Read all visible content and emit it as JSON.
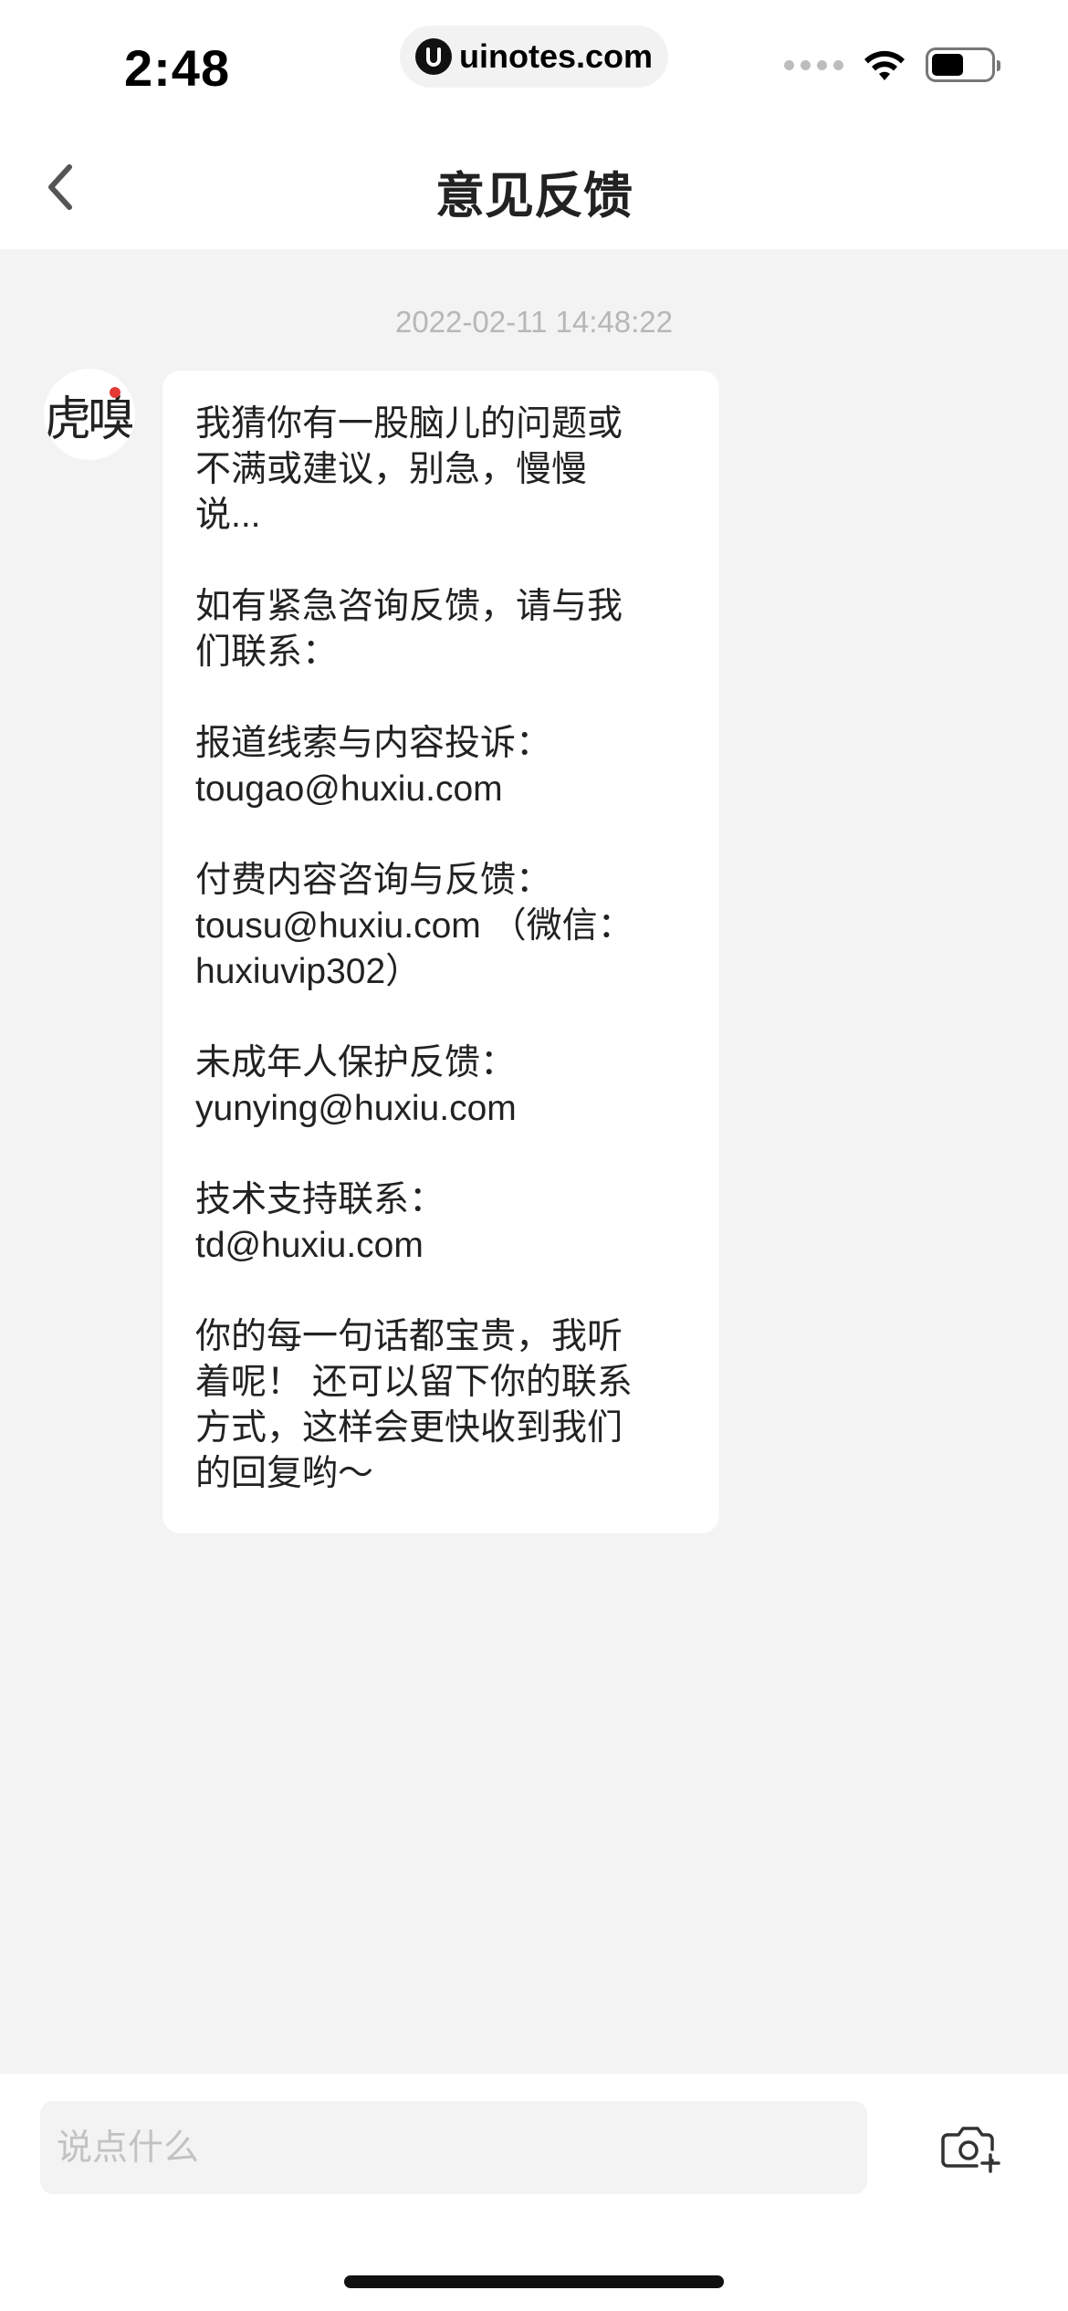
{
  "status_bar": {
    "time": "2:48",
    "url": "uinotes.com",
    "battery_level": 0.55
  },
  "nav": {
    "title": "意见反馈",
    "back_icon": "chevron-left-icon"
  },
  "chat": {
    "timestamp": "2022-02-11 14:48:22",
    "avatar_text": "虎嗅",
    "message_paragraphs": [
      {
        "lines": [
          "我猜你有一股脑儿的问题或",
          "不满或建议，别急，慢慢",
          "说..."
        ]
      },
      {
        "lines": [
          "如有紧急咨询反馈，请与我",
          "们联系："
        ]
      },
      {
        "lines": [
          "报道线索与内容投诉：",
          "tougao@huxiu.com"
        ]
      },
      {
        "lines": [
          "付费内容咨询与反馈：",
          "tousu@huxiu.com （微信：",
          "huxiuvip302）"
        ]
      },
      {
        "lines": [
          "未成年人保护反馈：",
          "yunying@huxiu.com"
        ]
      },
      {
        "lines": [
          "技术支持联系：",
          "td@huxiu.com"
        ]
      },
      {
        "lines": [
          "你的每一句话都宝贵，我听",
          "着呢！ 还可以留下你的联系",
          "方式，这样会更快收到我们",
          "的回复哟～"
        ]
      }
    ]
  },
  "composer": {
    "placeholder": "说点什么",
    "value": "",
    "camera_icon": "camera-add-icon"
  }
}
